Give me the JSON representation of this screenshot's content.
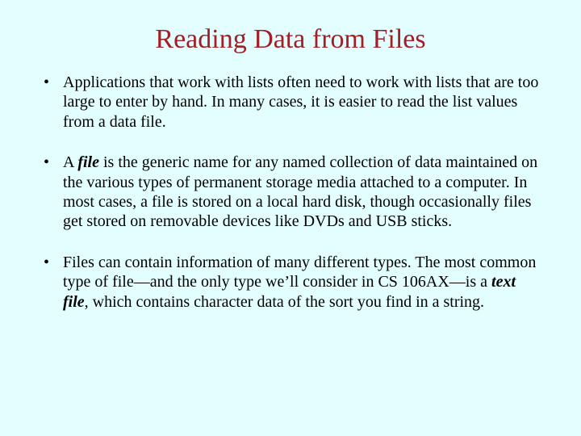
{
  "title": "Reading Data from Files",
  "bullets": [
    {
      "pre": "Applications that work with lists often need to work with lists that are too large to enter by hand.  In many cases, it is easier to read the list values from a data file."
    },
    {
      "pre": "A ",
      "term": "file",
      "post": " is the generic name for any named collection of data maintained on the various types of permanent storage media attached to a computer.  In most cases, a file is stored on a local hard disk, though occasionally files get stored on removable devices like DVDs and USB sticks."
    },
    {
      "pre": "Files can contain information of many different types. The most common type of file—and the only type we’ll consider in CS 106AX—is a ",
      "term": "text file",
      "post": ", which contains character data of the sort you find in a string."
    }
  ]
}
